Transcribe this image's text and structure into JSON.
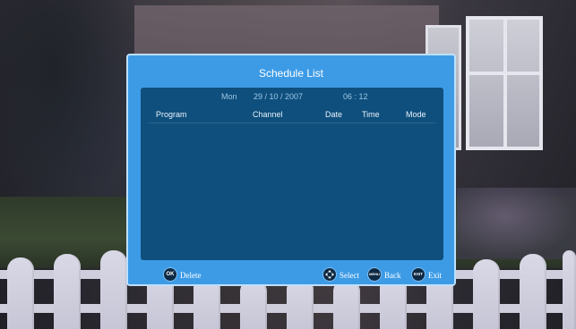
{
  "dialog": {
    "title": "Schedule List"
  },
  "datetime": {
    "day": "Mon",
    "date": "29 / 10 / 2007",
    "time": "06 : 12"
  },
  "table": {
    "columns": [
      "Program",
      "Channel",
      "Date",
      "Time",
      "Mode"
    ],
    "rows": []
  },
  "footer": {
    "ok_key": "OK",
    "ok_label": "Delete",
    "select_label": "Select",
    "menu_key": "MENU",
    "menu_label": "Back",
    "exit_key": "EXIT",
    "exit_label": "Exit"
  },
  "colors": {
    "dialog_bg": "#3d9be6",
    "panel_bg": "#0f4f7d",
    "accent_text": "#9cc6e6"
  }
}
